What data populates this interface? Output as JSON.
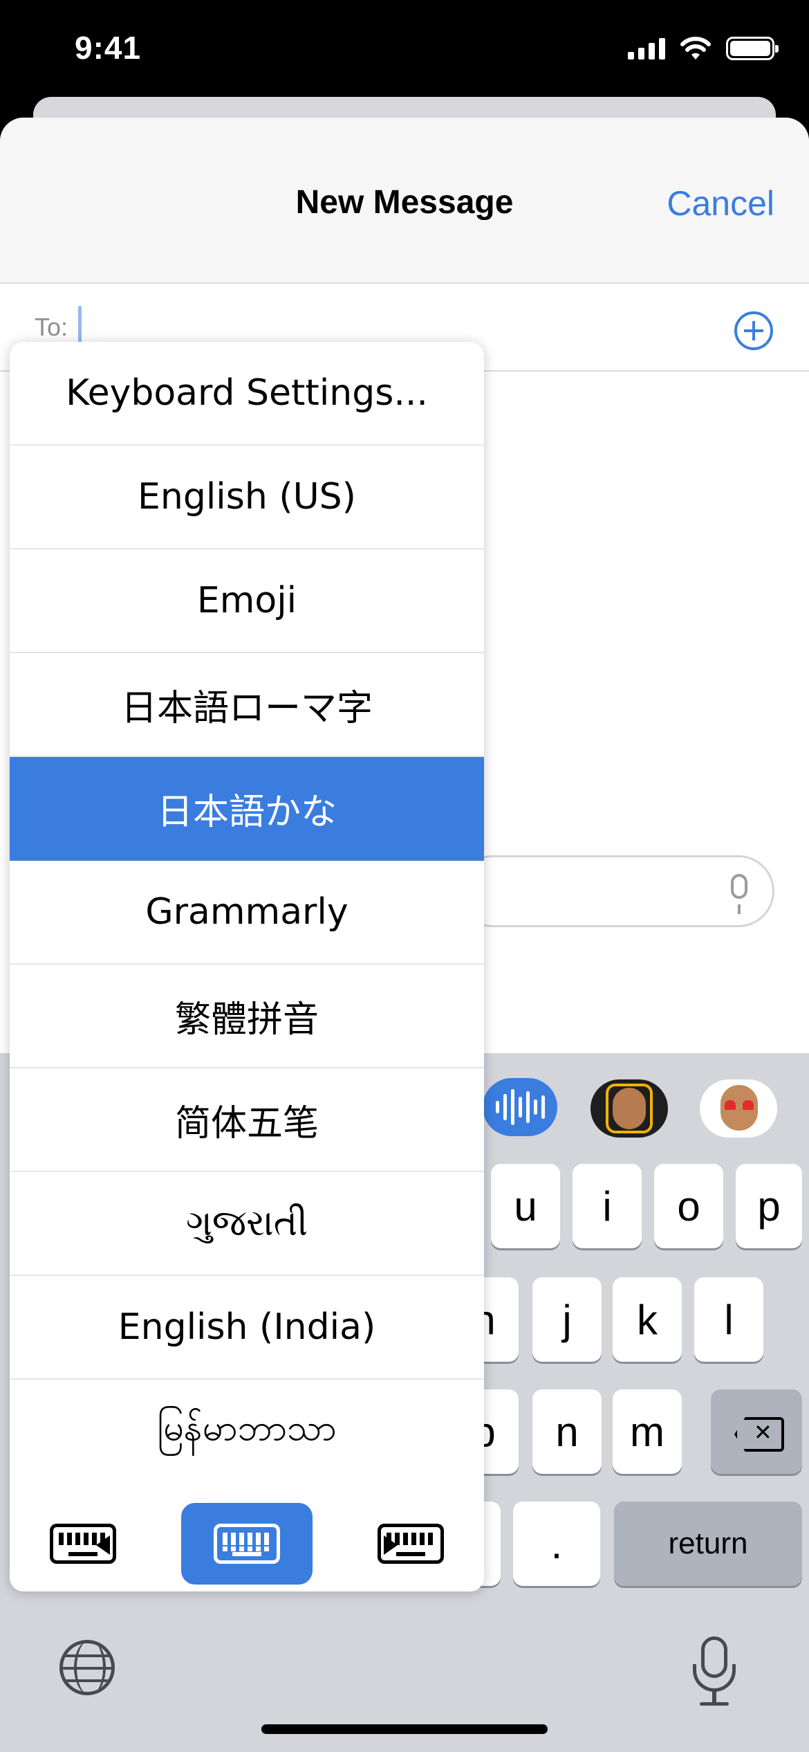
{
  "status_bar": {
    "time": "9:41"
  },
  "header": {
    "title": "New Message",
    "cancel_label": "Cancel"
  },
  "recipient": {
    "label": "To:",
    "value": ""
  },
  "language_menu": {
    "items": [
      {
        "label": "Keyboard Settings..."
      },
      {
        "label": "English (US)"
      },
      {
        "label": "Emoji"
      },
      {
        "label": "日本語ローマ字"
      },
      {
        "label": "日本語かな",
        "selected": true
      },
      {
        "label": "Grammarly"
      },
      {
        "label": "繁體拼音"
      },
      {
        "label": "简体五笔"
      },
      {
        "label": "ગુજરાતી"
      },
      {
        "label": "English (India)"
      },
      {
        "label": "မြန်မာဘာသာ"
      }
    ],
    "keyboard_modes": [
      {
        "name": "left-handed",
        "active": false
      },
      {
        "name": "full",
        "active": true
      },
      {
        "name": "right-handed",
        "active": false
      }
    ]
  },
  "keyboard": {
    "row1": [
      "u",
      "i",
      "o",
      "p"
    ],
    "row2": [
      "h",
      "j",
      "k",
      "l"
    ],
    "row3": [
      "b",
      "n",
      "m"
    ],
    "row4_period": ".",
    "return_label": "return"
  },
  "colors": {
    "accent": "#3a7ddf",
    "keyboard_bg": "#d3d5db",
    "header_bg": "#f6f6f6"
  },
  "icons": [
    "signal-icon",
    "wifi-icon",
    "battery-icon",
    "add-contact-icon",
    "microphone-icon",
    "audio-messages-icon",
    "memoji-icon",
    "backspace-icon",
    "globe-icon",
    "keyboard-icon"
  ]
}
